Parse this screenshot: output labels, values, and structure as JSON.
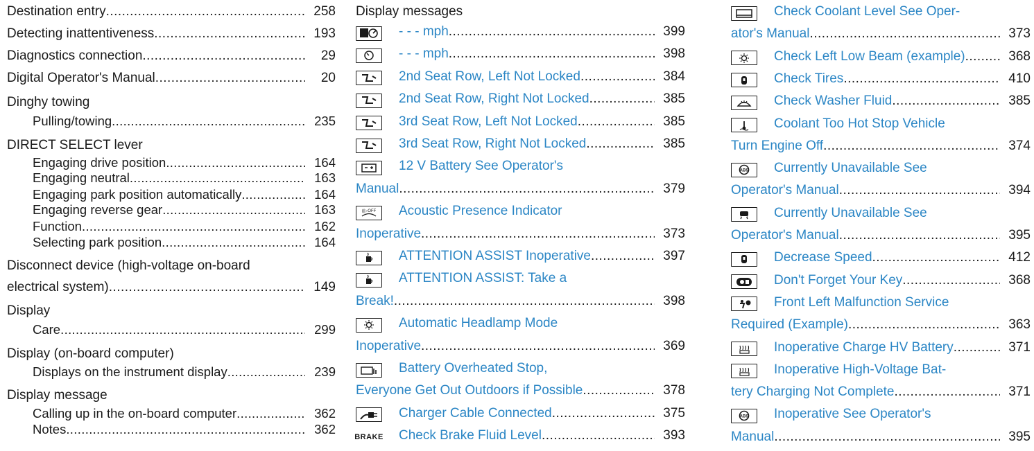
{
  "col1": [
    {
      "kind": "main",
      "text": "Destination entry",
      "page": "258"
    },
    {
      "kind": "main",
      "text": "Detecting inattentiveness",
      "page": "193"
    },
    {
      "kind": "main",
      "text": "Diagnostics connection",
      "page": "29"
    },
    {
      "kind": "main",
      "text": "Digital Operator's Manual",
      "page": "20"
    },
    {
      "kind": "head",
      "text": "Dinghy towing"
    },
    {
      "kind": "sub",
      "text": "Pulling/towing",
      "page": "235"
    },
    {
      "kind": "head",
      "text": "DIRECT SELECT lever"
    },
    {
      "kind": "sub",
      "text": "Engaging drive position",
      "page": "164"
    },
    {
      "kind": "sub",
      "text": "Engaging neutral",
      "page": "163"
    },
    {
      "kind": "sub",
      "text": "Engaging park position automatically",
      "page": "164"
    },
    {
      "kind": "sub",
      "text": "Engaging reverse gear",
      "page": "163"
    },
    {
      "kind": "sub",
      "text": "Function",
      "page": "162"
    },
    {
      "kind": "sub",
      "text": "Selecting park position",
      "page": "164"
    },
    {
      "kind": "head",
      "text": "Disconnect device (high-voltage on-board"
    },
    {
      "kind": "main",
      "text": "electrical system)",
      "page": "149"
    },
    {
      "kind": "head",
      "text": "Display"
    },
    {
      "kind": "sub",
      "text": "Care",
      "page": "299"
    },
    {
      "kind": "head",
      "text": "Display (on-board computer)"
    },
    {
      "kind": "sub",
      "text": "Displays on the instrument display",
      "page": "239"
    },
    {
      "kind": "head",
      "text": "Display message"
    },
    {
      "kind": "sub",
      "text": "Calling up in the on-board computer",
      "page": "362"
    },
    {
      "kind": "sub",
      "text": "Notes",
      "page": "362"
    }
  ],
  "col2_heading": "Display messages",
  "col2": [
    {
      "kind": "msg",
      "icon": "speed-limiter-icon",
      "text": "- - - mph",
      "page": "399"
    },
    {
      "kind": "msg",
      "icon": "speedometer-icon",
      "text": "- - - mph",
      "page": "398"
    },
    {
      "kind": "msg",
      "icon": "seat-icon",
      "text": "2nd Seat Row, Left Not Locked",
      "page": "384"
    },
    {
      "kind": "msg",
      "icon": "seat-icon",
      "text": "2nd Seat Row, Right Not Locked",
      "page": "385"
    },
    {
      "kind": "msg",
      "icon": "seat-icon",
      "text": "3rd Seat Row, Left Not Locked",
      "page": "385"
    },
    {
      "kind": "msg",
      "icon": "seat-icon",
      "text": "3rd Seat Row, Right Not Locked",
      "page": "385"
    },
    {
      "kind": "msg",
      "icon": "battery-icon",
      "text": "12 V Battery See Operator's"
    },
    {
      "kind": "plain",
      "text": "Manual",
      "page": "379"
    },
    {
      "kind": "msg",
      "icon": "acoustic-presence-icon",
      "text": "Acoustic Presence Indicator"
    },
    {
      "kind": "plain",
      "text": "Inoperative",
      "page": "373"
    },
    {
      "kind": "msg",
      "icon": "coffee-cup-icon",
      "text": "ATTENTION ASSIST Inoperative",
      "page": "397"
    },
    {
      "kind": "msg",
      "icon": "coffee-cup-icon",
      "text": "ATTENTION ASSIST: Take a"
    },
    {
      "kind": "plain",
      "text": "Break!",
      "page": "398"
    },
    {
      "kind": "msg",
      "icon": "headlamp-icon",
      "text": "Automatic Headlamp Mode"
    },
    {
      "kind": "plain",
      "text": "Inoperative",
      "page": "369"
    },
    {
      "kind": "msg",
      "icon": "battery-heat-icon",
      "text": "Battery Overheated Stop,"
    },
    {
      "kind": "plain",
      "text": "Everyone Get Out Outdoors if Possible",
      "page": "378"
    },
    {
      "kind": "msg",
      "icon": "charger-cable-icon",
      "text": "Charger Cable Connected",
      "page": "375"
    },
    {
      "kind": "msg",
      "icon": "brake-icon",
      "text": "Check Brake Fluid Level",
      "page": "393"
    }
  ],
  "col3": [
    {
      "kind": "msg",
      "icon": "coolant-level-icon",
      "text": "Check Coolant Level See Oper-"
    },
    {
      "kind": "plain",
      "text": "ator's Manual",
      "page": "373"
    },
    {
      "kind": "msg",
      "icon": "headlamp-icon",
      "text": "Check Left Low Beam (example)",
      "page": "368"
    },
    {
      "kind": "msg",
      "icon": "tire-icon",
      "text": "Check Tires",
      "page": "410"
    },
    {
      "kind": "msg",
      "icon": "washer-fluid-icon",
      "text": "Check Washer Fluid",
      "page": "385"
    },
    {
      "kind": "msg",
      "icon": "coolant-temp-icon",
      "text": "Coolant Too Hot Stop Vehicle"
    },
    {
      "kind": "plain",
      "text": "Turn Engine Off",
      "page": "374"
    },
    {
      "kind": "msg",
      "icon": "abs-icon",
      "text": "Currently Unavailable See"
    },
    {
      "kind": "plain",
      "text": "Operator's Manual",
      "page": "394"
    },
    {
      "kind": "msg",
      "icon": "lane-assist-icon",
      "text": "Currently Unavailable See"
    },
    {
      "kind": "plain",
      "text": "Operator's Manual",
      "page": "395"
    },
    {
      "kind": "msg",
      "icon": "tire-icon",
      "text": "Decrease Speed",
      "page": "412"
    },
    {
      "kind": "msg",
      "icon": "key-icon",
      "text": "Don't Forget Your Key",
      "page": "368"
    },
    {
      "kind": "msg",
      "icon": "airbag-icon",
      "text": "Front Left Malfunction Service"
    },
    {
      "kind": "plain",
      "text": "Required (Example)",
      "page": "363"
    },
    {
      "kind": "msg",
      "icon": "hv-battery-icon",
      "text": "Inoperative Charge HV Battery",
      "page": "371"
    },
    {
      "kind": "msg",
      "icon": "hv-battery-icon",
      "text": "Inoperative High-Voltage Bat-"
    },
    {
      "kind": "plain",
      "text": "tery Charging Not Complete",
      "page": "371"
    },
    {
      "kind": "msg",
      "icon": "abs-icon",
      "text": "Inoperative See Operator's"
    },
    {
      "kind": "plain",
      "text": "Manual",
      "page": "395"
    }
  ],
  "colors": {
    "link": "#2b86c5",
    "text": "#1a1a1a"
  }
}
